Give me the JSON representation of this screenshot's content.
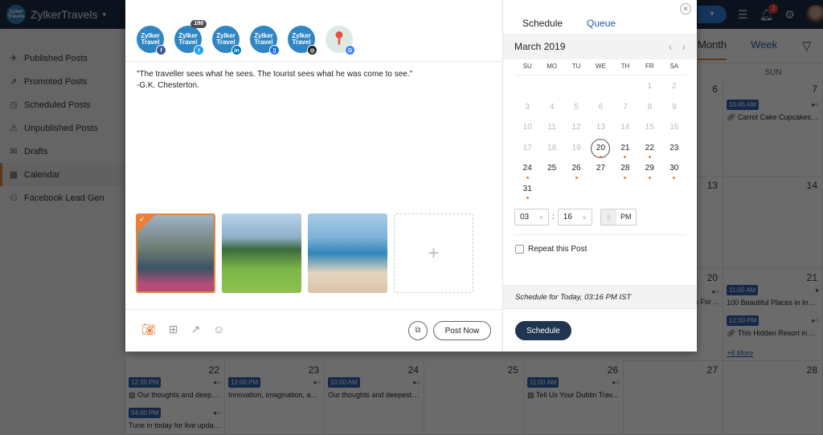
{
  "app": {
    "brand": "ZylkerTravels",
    "logo_text": "Zylker Travels",
    "notification_count": "2"
  },
  "sidebar": {
    "items": [
      {
        "label": "Published Posts",
        "icon": "✈"
      },
      {
        "label": "Promoted Posts",
        "icon": "⇗"
      },
      {
        "label": "Scheduled Posts",
        "icon": "◷"
      },
      {
        "label": "Unpublished Posts",
        "icon": "⚠"
      },
      {
        "label": "Drafts",
        "icon": "✉"
      },
      {
        "label": "Calendar",
        "icon": "▦",
        "active": true
      },
      {
        "label": "Facebook Lead Gen",
        "icon": "⚇"
      }
    ]
  },
  "calendar": {
    "views": [
      "Month",
      "Week"
    ],
    "day_header": "SUN",
    "days": {
      "d6": "6",
      "d7": "7",
      "d13": "13",
      "d14": "14",
      "d20": "20",
      "d21": "21",
      "d22": "22",
      "d23": "23",
      "d24": "24",
      "d25": "25",
      "d26": "26",
      "d27": "27",
      "d28": "28"
    },
    "events": {
      "e7a": {
        "time": "10:45 AM",
        "title": "Carrot Cake Cupcakes w..."
      },
      "e20a": {
        "title": "s For ..."
      },
      "e21a": {
        "time": "11:00 AM",
        "title": "100 Beautiful Places in Indi..."
      },
      "e21b": {
        "time": "12:30 PM",
        "title": "This Hidden Resort in Ar..."
      },
      "e21more": "+6 More",
      "e22a": {
        "time": "12:30 PM",
        "title": "Our thoughts and deepe..."
      },
      "e22b": {
        "time": "04:00 PM",
        "title": "Tune in today for live updat..."
      },
      "e23a": {
        "time": "12:00 PM",
        "title": "Innovation, imagination, an..."
      },
      "e24a": {
        "time": "10:00 AM",
        "title": "Our thoughts and deepest s..."
      },
      "e26a": {
        "time": "11:00 AM",
        "title": "Tell Us Your Dublin Trav..."
      }
    }
  },
  "composer": {
    "accounts": [
      {
        "name": "Zylker Travel",
        "network": "facebook",
        "badge": "f",
        "color": "#3b5998"
      },
      {
        "name": "Zylker Travel",
        "network": "twitter",
        "badge": "t",
        "color": "#1da1f2",
        "count": "186"
      },
      {
        "name": "Zylker Travel",
        "network": "linkedin",
        "badge": "in",
        "color": "#0077b5"
      },
      {
        "name": "Zylker Travel",
        "network": "google-my-business-page",
        "badge": "▯",
        "color": "#1a73e8"
      },
      {
        "name": "Zylker Travel",
        "network": "instagram",
        "badge": "◎",
        "color": "#222222"
      },
      {
        "name": "",
        "network": "google-my-business",
        "badge": "G",
        "color": "#4285f4"
      }
    ],
    "text": "\"The traveller sees what he sees. The tourist sees what he was come to see.\"\n-G.K. Chesterton.",
    "add_media": "+",
    "post_now": "Post Now"
  },
  "scheduler": {
    "tabs": [
      "Schedule",
      "Queue"
    ],
    "month": "March 2019",
    "weekdays": [
      "SU",
      "MO",
      "TU",
      "WE",
      "TH",
      "FR",
      "SA"
    ],
    "today": 20,
    "dot_days": [
      20,
      21,
      22,
      24,
      26,
      28,
      29,
      30,
      31
    ],
    "days_in_month": 31,
    "first_weekday": 5,
    "hour": "03",
    "minute": "16",
    "ampm": "PM",
    "am_label": "||",
    "repeat_label": "Repeat this Post",
    "repeat_checked": false,
    "summary": "Schedule for Today, 03:16 PM  IST",
    "schedule_button": "Schedule"
  },
  "colors": {
    "accent": "#e8823a",
    "primary": "#1f3550",
    "link": "#2a5aa8",
    "event": "#2f5fb0"
  }
}
